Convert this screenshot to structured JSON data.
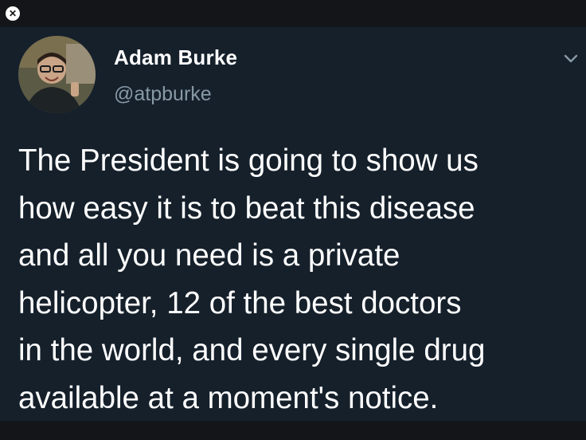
{
  "viewer": {
    "close_icon": "close-icon"
  },
  "tweet": {
    "author": {
      "name": "Adam Burke",
      "handle": "@atpburke"
    },
    "text": "The President is going to show us\nhow easy it is to beat this disease\nand all you need is a private\nhelicopter, 12 of the best doctors\nin the world, and every single drug\navailable at a moment's notice.",
    "menu_icon": "chevron-down-icon"
  },
  "colors": {
    "background": "#15202b",
    "text": "#ffffff",
    "secondary_text": "#8899a6"
  }
}
